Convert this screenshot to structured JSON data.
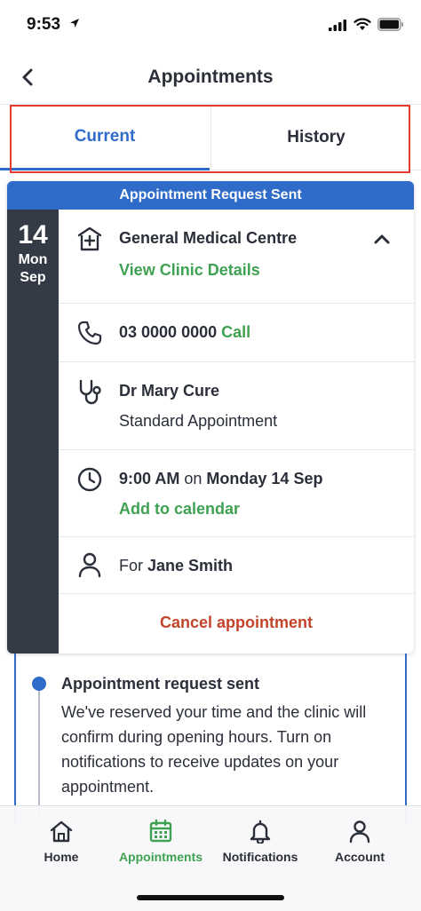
{
  "status_bar": {
    "time": "9:53"
  },
  "header": {
    "title": "Appointments"
  },
  "tabs": [
    {
      "label": "Current",
      "active": true
    },
    {
      "label": "History",
      "active": false
    }
  ],
  "appointment": {
    "banner": "Appointment Request Sent",
    "date": {
      "day": "14",
      "weekday": "Mon",
      "month": "Sep"
    },
    "clinic": {
      "name": "General Medical Centre",
      "details_link": "View Clinic Details"
    },
    "phone": {
      "number": "03 0000 0000",
      "call_label": "Call"
    },
    "doctor": {
      "name": "Dr Mary Cure",
      "type": "Standard Appointment"
    },
    "time": {
      "time": "9:00 AM",
      "on": "on",
      "date_long": "Monday 14 Sep",
      "calendar_label": "Add to calendar"
    },
    "patient": {
      "for_label": "For",
      "name": "Jane Smith"
    },
    "cancel_label": "Cancel appointment"
  },
  "timeline": {
    "title": "Appointment request sent",
    "body": "We've reserved your time and the clinic will confirm during opening hours. Turn on notifications to receive updates on your appointment."
  },
  "bottom_nav": [
    {
      "label": "Home",
      "icon": "home-icon"
    },
    {
      "label": "Appointments",
      "icon": "calendar-icon",
      "active": true
    },
    {
      "label": "Notifications",
      "icon": "bell-icon"
    },
    {
      "label": "Account",
      "icon": "person-icon"
    }
  ],
  "colors": {
    "primary_blue": "#2f6bc8",
    "success_green": "#3fa152",
    "danger_red": "#c3442a",
    "date_column": "#343b47",
    "highlight": "#e53a2f"
  }
}
